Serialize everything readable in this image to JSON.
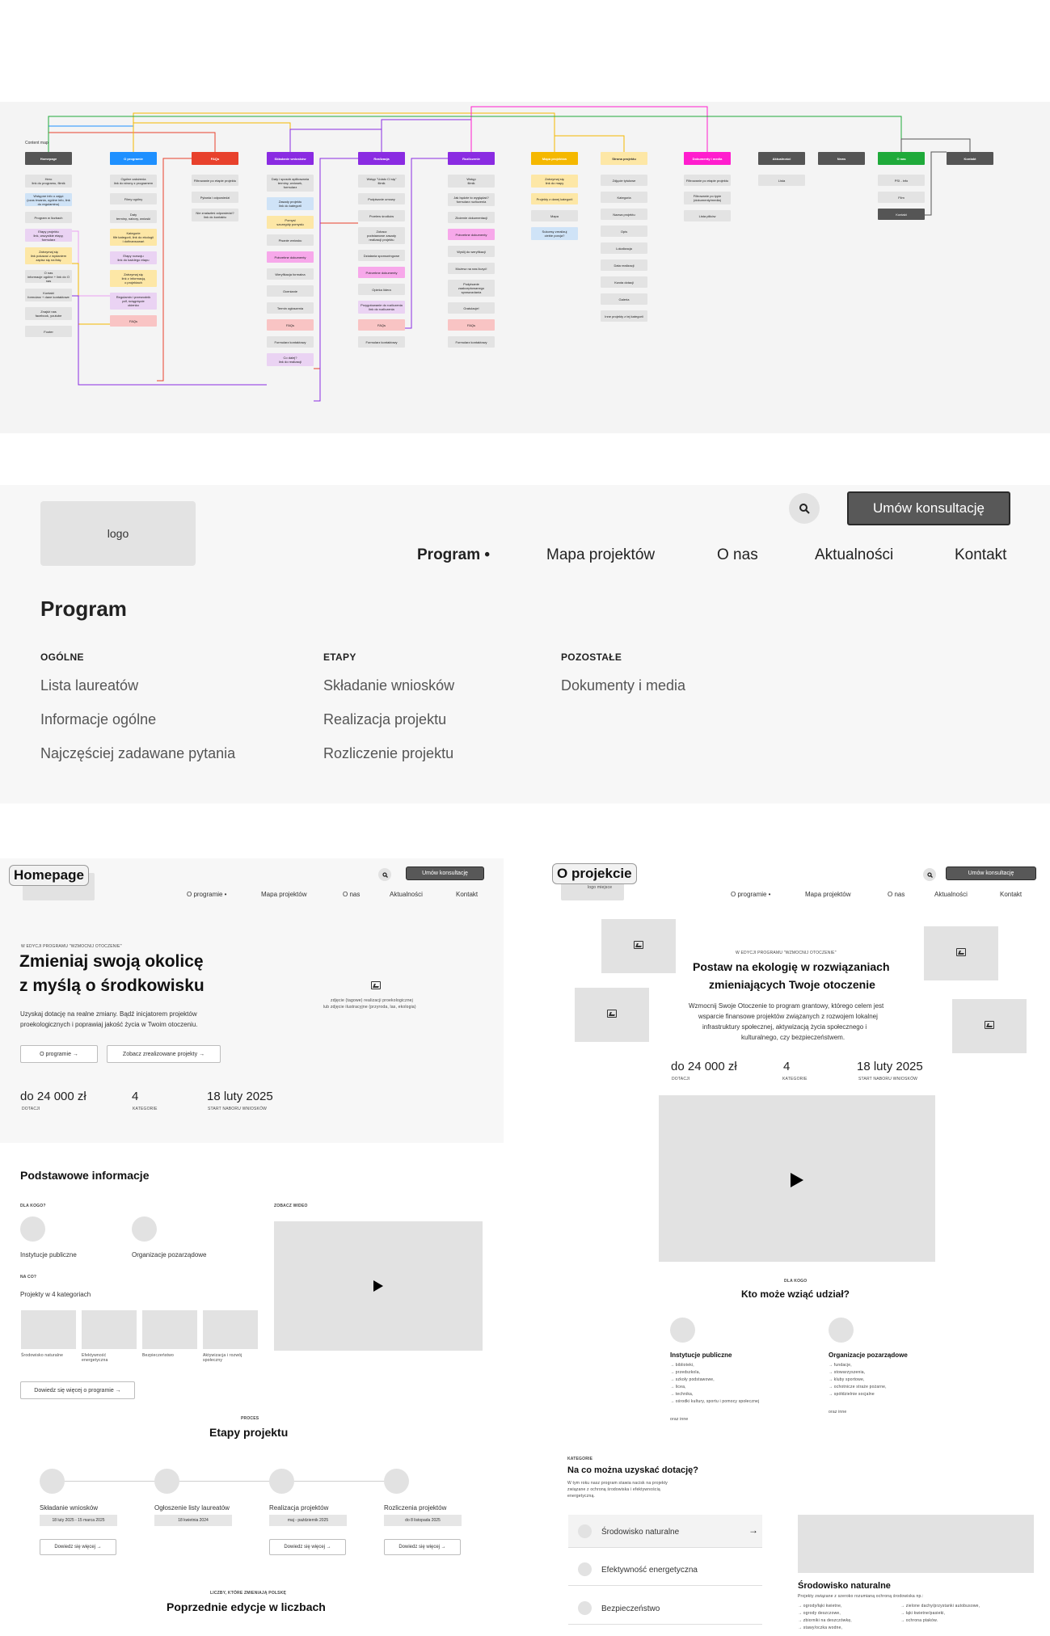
{
  "content_map": {
    "title": "Content map",
    "columns": [
      {
        "head": "Homepage",
        "color": "#555555",
        "items": [
          {
            "label": "Hero\nlink do programu, filmik",
            "color": "#e3e3e3"
          },
          {
            "label": "Wstępne info o zajęć\n(czas trwania, ogólne info, link do regulaminu)",
            "color": "#cfe3f7"
          },
          {
            "label": "Program w liczbach",
            "color": "#e3e3e3"
          },
          {
            "label": "Etapy projektu\nlink, wszystkie etapy, formularz",
            "color": "#ead3f3"
          },
          {
            "label": "Zatrzymaj się\nlink pokazać z wydaniem\nzapisz się na listę",
            "color": "#fde7a6"
          },
          {
            "label": "O nas\ninformacje ogólne + link do O nas",
            "color": "#e3e3e3"
          },
          {
            "label": "Kontakt\nformularz + dane kontaktowe",
            "color": "#e3e3e3"
          },
          {
            "label": "Znajdź nas\nfacebook, youtube",
            "color": "#e3e3e3"
          },
          {
            "label": "Footer",
            "color": "#e3e3e3"
          }
        ]
      },
      {
        "head": "O programie",
        "color": "#1e90ff",
        "items": [
          {
            "label": "Ogólne założenia\nlink do strony z programem",
            "color": "#e3e3e3"
          },
          {
            "label": "Filmy ogólny",
            "color": "#e3e3e3"
          },
          {
            "label": "Daty\nterminy, nabory, wnioski",
            "color": "#e3e3e3"
          },
          {
            "label": "Kategorie\nfiltr kategorii, link do ekologii\ni dofinansowań",
            "color": "#fde7a6"
          },
          {
            "label": "Etapy rozwoju\nlink do każdego etapu",
            "color": "#ead3f3"
          },
          {
            "label": "Zatrzymaj się\nlink z informacją\no projektach",
            "color": "#fde7a6"
          },
          {
            "label": "Regulamin i przewodnik\npdf, ściągnięcie\nokienko",
            "color": "#ead3f3"
          },
          {
            "label": "FAQs",
            "color": "#f9c4c4"
          }
        ]
      },
      {
        "head": "FAQs",
        "color": "#e8412c",
        "items": [
          {
            "label": "Filtrowanie po etapie projektu",
            "color": "#e3e3e3"
          },
          {
            "label": "Pytania i odpowiedzi",
            "color": "#e3e3e3"
          },
          {
            "label": "Nie znalazłeś odpowiedzi?\nlink do kontaktu",
            "color": "#e3e3e3"
          }
        ]
      },
      {
        "head": "Składanie wniosków",
        "color": "#8a2be2",
        "items": [
          {
            "label": "Daty i sposób aplikowania\nterminy, wniosek,\nformularz",
            "color": "#e3e3e3"
          },
          {
            "label": "Zasady projektu\nlink do kategorii",
            "color": "#cfe3f7"
          },
          {
            "label": "Pomysł\nszczegóły pomysłu",
            "color": "#fde7a6"
          },
          {
            "label": "Pisanie wniosku",
            "color": "#e3e3e3"
          },
          {
            "label": "Potrzebne dokumenty",
            "color": "#f7a8ea"
          },
          {
            "label": "Weryfikacja formalna",
            "color": "#e3e3e3"
          },
          {
            "label": "Ocenianie",
            "color": "#e3e3e3"
          },
          {
            "label": "Termin ogłoszenia",
            "color": "#e3e3e3"
          },
          {
            "label": "FAQs",
            "color": "#f9c4c4"
          },
          {
            "label": "Formularz kontaktowy",
            "color": "#e3e3e3"
          },
          {
            "label": "Co dalej?\nlink do realizacji",
            "color": "#ead3f3"
          }
        ]
      },
      {
        "head": "Realizacja",
        "color": "#8a2be2",
        "items": [
          {
            "label": "Wstęp \"Udało Ci się\"\nfilmik",
            "color": "#e3e3e3"
          },
          {
            "label": "Podpisanie umowy",
            "color": "#e3e3e3"
          },
          {
            "label": "Przelew środków",
            "color": "#e3e3e3"
          },
          {
            "label": "Zobacz\npodstawowe zasady\nrealizacji projektu",
            "color": "#e3e3e3"
          },
          {
            "label": "Działania sponsoringowe",
            "color": "#e3e3e3"
          },
          {
            "label": "Potrzebne dokumenty",
            "color": "#f7a8ea"
          },
          {
            "label": "Opieka lidera",
            "color": "#e3e3e3"
          },
          {
            "label": "Przygotowanie do rozliczenia\nlink do rozliczenia",
            "color": "#ead3f3"
          },
          {
            "label": "FAQs",
            "color": "#f9c4c4"
          },
          {
            "label": "Formularz kontaktowy",
            "color": "#e3e3e3"
          }
        ]
      },
      {
        "head": "Rozliczenie",
        "color": "#8a2be2",
        "items": [
          {
            "label": "Wstęp\nfilmik",
            "color": "#e3e3e3"
          },
          {
            "label": "Jak będzie to wyglądać?\nformularz rozliczenia",
            "color": "#e3e3e3"
          },
          {
            "label": "Złożenie dokumentacji",
            "color": "#e3e3e3"
          },
          {
            "label": "Potrzebne dokumenty",
            "color": "#f7a8ea"
          },
          {
            "label": "Wyślij do weryfikacji",
            "color": "#e3e3e3"
          },
          {
            "label": "Możesz na nas liczyć!",
            "color": "#e3e3e3"
          },
          {
            "label": "Podpisanie\nzaakceptowanego\nsprawozdania",
            "color": "#e3e3e3"
          },
          {
            "label": "Gratulacje!",
            "color": "#e3e3e3"
          },
          {
            "label": "FAQs",
            "color": "#f9c4c4"
          },
          {
            "label": "Formularz kontaktowy",
            "color": "#e3e3e3"
          }
        ]
      },
      {
        "head": "Mapa projektów",
        "color": "#f5b800",
        "items": [
          {
            "label": "Zatrzymaj się\nlink do mapy",
            "color": "#fde7a6"
          },
          {
            "label": "Projekty z danej kategorii",
            "color": "#fde7a6"
          },
          {
            "label": "Mapa",
            "color": "#e3e3e3"
          },
          {
            "label": "Sukcesy zrealizuj\nciebie porcja?",
            "color": "#cfe3f7"
          }
        ]
      },
      {
        "head": "Strona projektu",
        "color": "#fde7a6",
        "items": [
          {
            "label": "Zdjęcie tytułowe",
            "color": "#e3e3e3"
          },
          {
            "label": "Kategoria",
            "color": "#e3e3e3"
          },
          {
            "label": "Nazwa projektu",
            "color": "#e3e3e3"
          },
          {
            "label": "Opis",
            "color": "#e3e3e3"
          },
          {
            "label": "Lokalizacja",
            "color": "#e3e3e3"
          },
          {
            "label": "Data realizacji",
            "color": "#e3e3e3"
          },
          {
            "label": "Kwota dotacji",
            "color": "#e3e3e3"
          },
          {
            "label": "Galeria",
            "color": "#e3e3e3"
          },
          {
            "label": "Inne projekty z tej kategorii",
            "color": "#e3e3e3"
          }
        ]
      },
      {
        "head": "Dokumenty i media",
        "color": "#ff1dce",
        "items": [
          {
            "label": "Filtrowanie po etapie projektu",
            "color": "#e3e3e3"
          },
          {
            "label": "Filtrowanie po typie\n(dokumenty/media)",
            "color": "#e3e3e3"
          },
          {
            "label": "Lista plików",
            "color": "#e3e3e3"
          }
        ]
      },
      {
        "head": "Aktualności",
        "color": "#555555",
        "items": [
          {
            "label": "Lista",
            "color": "#e3e3e3"
          }
        ]
      },
      {
        "head": "News",
        "color": "#555555",
        "items": []
      },
      {
        "head": "O nas",
        "color": "#1faa3a",
        "items": [
          {
            "label": "PSI - info",
            "color": "#e3e3e3"
          },
          {
            "label": "Film",
            "color": "#e3e3e3"
          },
          {
            "label": "Kontakt",
            "color": "#555555"
          }
        ]
      },
      {
        "head": "Kontakt",
        "color": "#555555",
        "items": []
      }
    ]
  },
  "nav_wireframe": {
    "logo": "logo",
    "cta": "Umów konsultację",
    "search_icon": "search-icon",
    "menu": [
      "Program •",
      "Mapa projektów",
      "O nas",
      "Aktualności",
      "Kontakt"
    ],
    "submenu_title": "Program",
    "columns": [
      {
        "head": "OGÓLNE",
        "links": [
          "Lista laureatów",
          "Informacje ogólne",
          "Najczęściej zadawane pytania"
        ]
      },
      {
        "head": "ETAPY",
        "links": [
          "Składanie wniosków",
          "Realizacja projektu",
          "Rozliczenie projektu"
        ]
      },
      {
        "head": "POZOSTAŁE",
        "links": [
          "Dokumenty i media"
        ]
      }
    ]
  },
  "homepage": {
    "label": "Homepage",
    "nav": [
      "O programie •",
      "Mapa projektów",
      "O nas",
      "Aktualności",
      "Kontakt"
    ],
    "cta": "Umów konsultację",
    "eyebrow": "W EDYCJI PROGRAMU \"WZMOCNIJ OTOCZENIE\"",
    "headline_1": "Zmieniaj swoją okolicę",
    "headline_2": "z myślą o środkowisku",
    "lead_1": "Uzyskaj dotację na realne zmiany. Bądź inicjatorem projektów",
    "lead_2": "proekologicznych i poprawiaj jakość życia w Twoim otoczeniu.",
    "btn_about": "O programie →",
    "btn_projects": "Zobacz zrealizowane projekty →",
    "image_caption_1": "zdjęcie (tagowe) realizacji proekologicznej",
    "image_caption_2": "lub zdjęcie ilustracyjne (przyroda, las, ekologia)",
    "stats": [
      {
        "value": "do 24 000 zł",
        "label": "DOTACJI"
      },
      {
        "value": "4",
        "label": "KATEGORIE"
      },
      {
        "value": "18 luty 2025",
        "label": "START NABORU WNIOSKÓW"
      }
    ],
    "basic_title": "Podstawowe informacje",
    "for_whom": "DLA KOGO?",
    "who": [
      "Instytucje publiczne",
      "Organizacje pozarządowe"
    ],
    "on_what": "NA CO?",
    "categories_line": "Projekty w 4 kategoriach",
    "categories": [
      "Środowisko naturalne",
      "Efektywność energetyczna",
      "Bezpieczeństwo",
      "Aktywizacja i rozwój społeczny"
    ],
    "video_label": "ZOBACZ WIDEO",
    "more_btn": "Dowiedz się więcej o programie →",
    "process_eyebrow": "PROCES",
    "process_title": "Etapy projektu",
    "steps": [
      {
        "title": "Składanie wniosków",
        "date": "18 luty 2025 - 15 marca 2025",
        "btn": "Dowiedz się więcej →"
      },
      {
        "title": "Ogłoszenie listy laureatów",
        "date": "18 kwietnia 2024",
        "btn": ""
      },
      {
        "title": "Realizacja projektów",
        "date": "maj - październik 2025",
        "btn": "Dowiedz się więcej →"
      },
      {
        "title": "Rozliczenia projektów",
        "date": "do 8 listopada 2025",
        "btn": "Dowiedz się więcej →"
      }
    ],
    "prev_eyebrow": "LICZBY, KTÓRE ZMIENIAJĄ POLSKĘ",
    "prev_title": "Poprzednie edycje w liczbach"
  },
  "about": {
    "label": "O projekcie",
    "logo_peek": "logo miejsce",
    "nav": [
      "O programie •",
      "Mapa projektów",
      "O nas",
      "Aktualności",
      "Kontakt"
    ],
    "cta": "Umów konsultację",
    "eyebrow": "W EDYCJI PROGRAMU \"WZMOCNIJ OTOCZENIE\"",
    "headline_1": "Postaw na ekologię w rozwiązaniach",
    "headline_2": "zmieniających Twoje otoczenie",
    "lead_1": "Wzmocnij Swoje Otoczenie to program grantowy, którego celem jest",
    "lead_2": "wsparcie finansowe projektów związanych z rozwojem lokalnej",
    "lead_3": "infrastruktury społecznej, aktywizacją życia społecznego i",
    "lead_4": "kulturalnego, czy bezpieczeństwem.",
    "stats": [
      {
        "value": "do 24 000 zł",
        "label": "DOTACJI"
      },
      {
        "value": "4",
        "label": "KATEGORIE"
      },
      {
        "value": "18 luty 2025",
        "label": "START NABORU WNIOSKÓW"
      }
    ],
    "who_eyebrow": "DLA KOGO",
    "who_title": "Kto może wziąć udział?",
    "groups": [
      {
        "title": "Instytucje publiczne",
        "items": [
          "→ biblioteki,",
          "→ przedszkola,",
          "→ szkoły podstawowe,",
          "→ licea,",
          "→ technika,",
          "→ ośrodki kultury, sportu i pomocy społecznej"
        ],
        "more": "oraz inne"
      },
      {
        "title": "Organizacje pozarządowe",
        "items": [
          "→ fundacje,",
          "→ stowarzyszenia,",
          "→ kluby sportowe,",
          "→ ochotnicze straże pożarne,",
          "→ spółdzielnie socjalne"
        ],
        "more": "oraz inne"
      }
    ],
    "cat_eyebrow": "KATEGORIE",
    "cat_title": "Na co można uzyskać dotację?",
    "cat_lead_1": "W tym roku nasz program stawia nacisk na projekty",
    "cat_lead_2": "związane z ochroną środowiska i efektywnością",
    "cat_lead_3": "energetyczną.",
    "categories": [
      "Środowisko naturalne",
      "Efektywność energetyczna",
      "Bezpieczeństwo"
    ],
    "detail_title": "Środowisko naturalne",
    "detail_lead": "Projekty związane z szeroko rozumianą ochroną środowiska np.:",
    "detail_left": [
      "→ ogrody/łąki kwietne,",
      "→ ogrody deszczowe,",
      "→ zbiorniki na deszczówkę,",
      "→ stawy/oczka wodne,"
    ],
    "detail_right": [
      "→ zielone dachy/przystanki autobusowe,",
      "→ łąki kwietne/pasieki,",
      "→ ochrona ptaków."
    ]
  }
}
